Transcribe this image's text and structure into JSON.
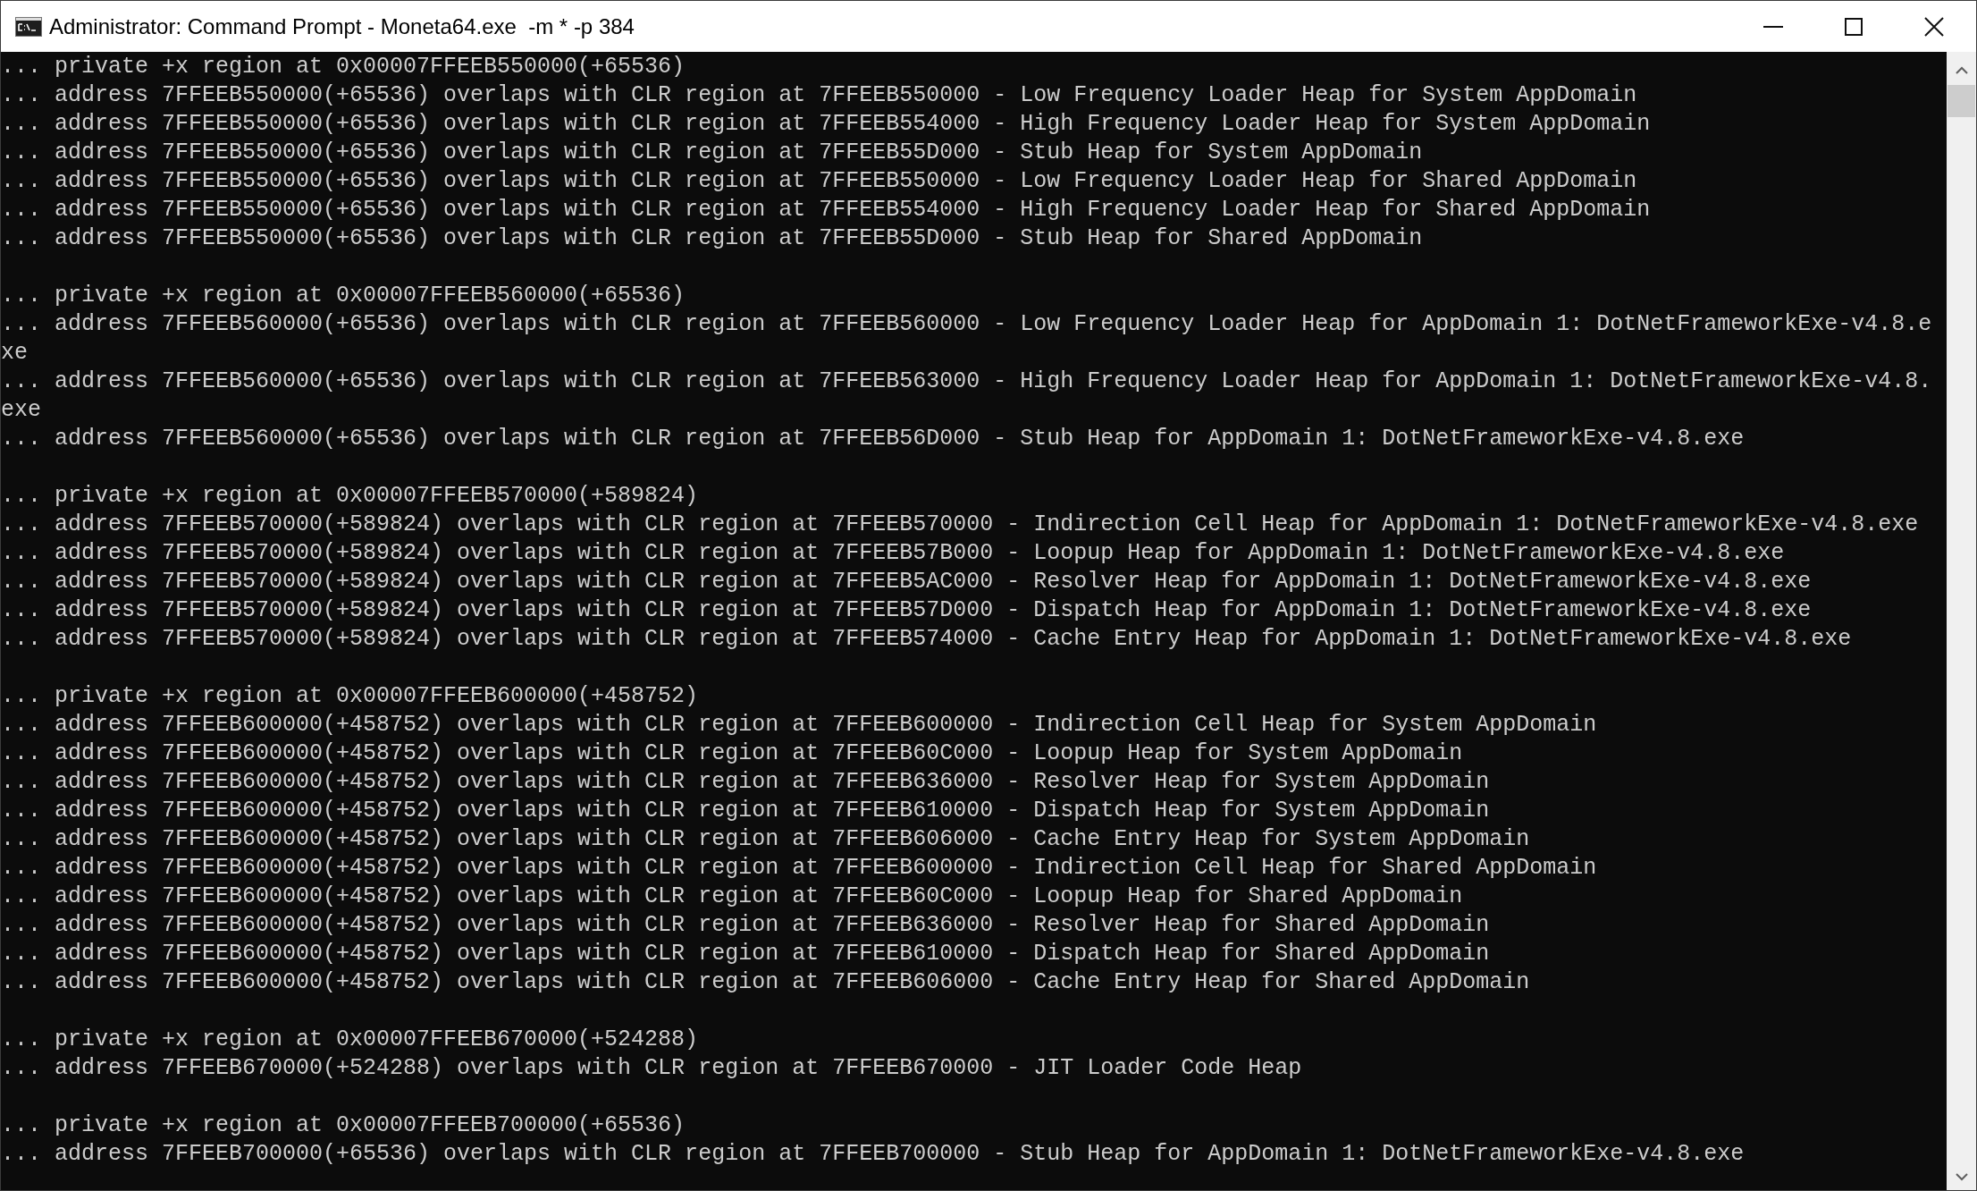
{
  "window": {
    "title": "Administrator: Command Prompt - Moneta64.exe  -m * -p 384"
  },
  "console": {
    "blocks": [
      {
        "lines": [
          "... private +x region at 0x00007FFEEB550000(+65536)",
          "... address 7FFEEB550000(+65536) overlaps with CLR region at 7FFEEB550000 - Low Frequency Loader Heap for System AppDomain",
          "... address 7FFEEB550000(+65536) overlaps with CLR region at 7FFEEB554000 - High Frequency Loader Heap for System AppDomain",
          "... address 7FFEEB550000(+65536) overlaps with CLR region at 7FFEEB55D000 - Stub Heap for System AppDomain",
          "... address 7FFEEB550000(+65536) overlaps with CLR region at 7FFEEB550000 - Low Frequency Loader Heap for Shared AppDomain",
          "... address 7FFEEB550000(+65536) overlaps with CLR region at 7FFEEB554000 - High Frequency Loader Heap for Shared AppDomain",
          "... address 7FFEEB550000(+65536) overlaps with CLR region at 7FFEEB55D000 - Stub Heap for Shared AppDomain"
        ]
      },
      {
        "lines": [
          "... private +x region at 0x00007FFEEB560000(+65536)",
          "... address 7FFEEB560000(+65536) overlaps with CLR region at 7FFEEB560000 - Low Frequency Loader Heap for AppDomain 1: DotNetFrameworkExe-v4.8.exe",
          "... address 7FFEEB560000(+65536) overlaps with CLR region at 7FFEEB563000 - High Frequency Loader Heap for AppDomain 1: DotNetFrameworkExe-v4.8.exe",
          "... address 7FFEEB560000(+65536) overlaps with CLR region at 7FFEEB56D000 - Stub Heap for AppDomain 1: DotNetFrameworkExe-v4.8.exe"
        ]
      },
      {
        "lines": [
          "... private +x region at 0x00007FFEEB570000(+589824)",
          "... address 7FFEEB570000(+589824) overlaps with CLR region at 7FFEEB570000 - Indirection Cell Heap for AppDomain 1: DotNetFrameworkExe-v4.8.exe",
          "... address 7FFEEB570000(+589824) overlaps with CLR region at 7FFEEB57B000 - Loopup Heap for AppDomain 1: DotNetFrameworkExe-v4.8.exe",
          "... address 7FFEEB570000(+589824) overlaps with CLR region at 7FFEEB5AC000 - Resolver Heap for AppDomain 1: DotNetFrameworkExe-v4.8.exe",
          "... address 7FFEEB570000(+589824) overlaps with CLR region at 7FFEEB57D000 - Dispatch Heap for AppDomain 1: DotNetFrameworkExe-v4.8.exe",
          "... address 7FFEEB570000(+589824) overlaps with CLR region at 7FFEEB574000 - Cache Entry Heap for AppDomain 1: DotNetFrameworkExe-v4.8.exe"
        ]
      },
      {
        "lines": [
          "... private +x region at 0x00007FFEEB600000(+458752)",
          "... address 7FFEEB600000(+458752) overlaps with CLR region at 7FFEEB600000 - Indirection Cell Heap for System AppDomain",
          "... address 7FFEEB600000(+458752) overlaps with CLR region at 7FFEEB60C000 - Loopup Heap for System AppDomain",
          "... address 7FFEEB600000(+458752) overlaps with CLR region at 7FFEEB636000 - Resolver Heap for System AppDomain",
          "... address 7FFEEB600000(+458752) overlaps with CLR region at 7FFEEB610000 - Dispatch Heap for System AppDomain",
          "... address 7FFEEB600000(+458752) overlaps with CLR region at 7FFEEB606000 - Cache Entry Heap for System AppDomain",
          "... address 7FFEEB600000(+458752) overlaps with CLR region at 7FFEEB600000 - Indirection Cell Heap for Shared AppDomain",
          "... address 7FFEEB600000(+458752) overlaps with CLR region at 7FFEEB60C000 - Loopup Heap for Shared AppDomain",
          "... address 7FFEEB600000(+458752) overlaps with CLR region at 7FFEEB636000 - Resolver Heap for Shared AppDomain",
          "... address 7FFEEB600000(+458752) overlaps with CLR region at 7FFEEB610000 - Dispatch Heap for Shared AppDomain",
          "... address 7FFEEB600000(+458752) overlaps with CLR region at 7FFEEB606000 - Cache Entry Heap for Shared AppDomain"
        ]
      },
      {
        "lines": [
          "... private +x region at 0x00007FFEEB670000(+524288)",
          "... address 7FFEEB670000(+524288) overlaps with CLR region at 7FFEEB670000 - JIT Loader Code Heap"
        ]
      },
      {
        "lines": [
          "... private +x region at 0x00007FFEEB700000(+65536)",
          "... address 7FFEEB700000(+65536) overlaps with CLR region at 7FFEEB700000 - Stub Heap for AppDomain 1: DotNetFrameworkExe-v4.8.exe"
        ]
      }
    ]
  }
}
